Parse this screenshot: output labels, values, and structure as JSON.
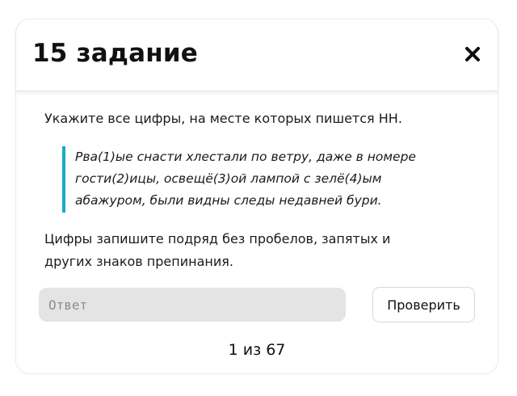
{
  "header": {
    "title": "15 задание",
    "close_icon": "close-icon"
  },
  "task": {
    "prompt": "Укажите все цифры, на месте которых пишется НН.",
    "quote": "Рва(1)ые снасти хлестали по ветру, даже в номере\nгости(2)ицы, освещё(3)ой лампой с зелё(4)ым\nабажуром, были видны следы недавней бури.",
    "instruction": "Цифры запишите подряд без пробелов, запятых и\nдругих знаков препинания."
  },
  "answer": {
    "placeholder": "Ответ",
    "value": "",
    "check_label": "Проверить"
  },
  "pagination": {
    "text": "1 из 67"
  },
  "colors": {
    "accent": "#1aa9c7",
    "input_bg": "#e4e4e4",
    "text": "#111111"
  }
}
